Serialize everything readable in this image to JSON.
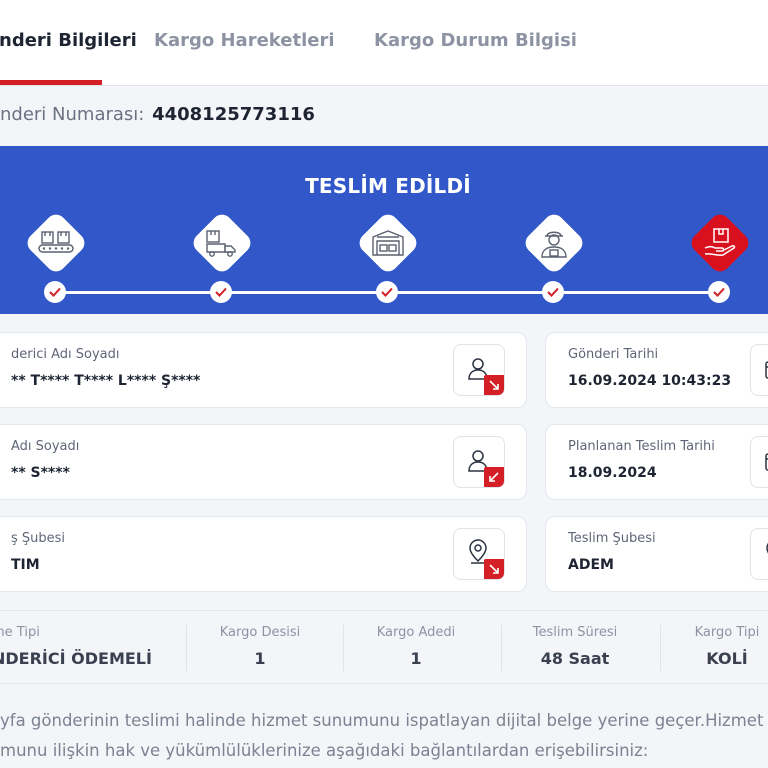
{
  "tabs": [
    {
      "label": "nderi Bilgileri",
      "active": true
    },
    {
      "label": "Kargo Hareketleri",
      "active": false
    },
    {
      "label": "Kargo Durum Bilgisi",
      "active": false
    }
  ],
  "tracking": {
    "label": "nderi Numarası:",
    "value": "4408125773116"
  },
  "status": {
    "title": "TESLİM EDİLDİ",
    "steps_completed": 5,
    "steps_total": 5
  },
  "steps": [
    {
      "icon": "conveyor-boxes-icon"
    },
    {
      "icon": "delivery-truck-icon"
    },
    {
      "icon": "warehouse-icon"
    },
    {
      "icon": "courier-person-icon"
    },
    {
      "icon": "hand-delivery-box-icon"
    }
  ],
  "cards": {
    "sender": {
      "label": "derici Adı Soyadı",
      "value": "** T**** T**** L**** Ş****"
    },
    "receiver": {
      "label": "Adı Soyadı",
      "value": "** S****"
    },
    "origin_branch": {
      "label": "ş Şubesi",
      "value": "TIM"
    },
    "send_date": {
      "label": "Gönderi Tarihi",
      "value": "16.09.2024 10:43:23"
    },
    "planned_date": {
      "label": "Planlanan Teslim Tarihi",
      "value": "18.09.2024"
    },
    "delivery_branch": {
      "label": "Teslim Şubesi",
      "value": "ADEM"
    }
  },
  "summary": [
    {
      "label": "me Tipi",
      "value": "NDERİCİ ÖDEMELİ"
    },
    {
      "label": "Kargo Desisi",
      "value": "1"
    },
    {
      "label": "Kargo Adedi",
      "value": "1"
    },
    {
      "label": "Teslim Süresi",
      "value": "48 Saat"
    },
    {
      "label": "Kargo Tipi",
      "value": "KOLİ"
    }
  ],
  "notice": {
    "line1": "yfa gönderinin teslimi halinde hizmet sunumunu ispatlayan dijital belge yerine geçer.Hizmet",
    "line2": "munu ilişkin hak ve yükümlülüklerinize aşağıdaki bağlantılardan erişebilirsiniz:"
  },
  "colors": {
    "accent_red": "#d51f26",
    "banner_blue": "#3157c9"
  }
}
